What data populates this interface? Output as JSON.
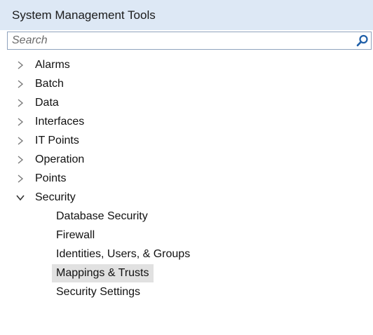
{
  "panel": {
    "title": "System Management Tools"
  },
  "search": {
    "placeholder": "Search",
    "value": ""
  },
  "tree": {
    "items": [
      {
        "label": "Alarms",
        "expanded": false
      },
      {
        "label": "Batch",
        "expanded": false
      },
      {
        "label": "Data",
        "expanded": false
      },
      {
        "label": "Interfaces",
        "expanded": false
      },
      {
        "label": "IT Points",
        "expanded": false
      },
      {
        "label": "Operation",
        "expanded": false
      },
      {
        "label": "Points",
        "expanded": false
      },
      {
        "label": "Security",
        "expanded": true
      }
    ],
    "security_children": [
      {
        "label": "Database Security",
        "selected": false
      },
      {
        "label": "Firewall",
        "selected": false
      },
      {
        "label": "Identities, Users, & Groups",
        "selected": false
      },
      {
        "label": "Mappings & Trusts",
        "selected": true
      },
      {
        "label": "Security Settings",
        "selected": false
      }
    ]
  },
  "icons": {
    "search": "search-icon",
    "collapsed": "chevron-right-icon",
    "expanded": "chevron-down-icon"
  },
  "colors": {
    "title_bar_bg": "#dde8f5",
    "search_border": "#8fa3bd",
    "selected_bg": "#e1e1e1",
    "search_icon": "#1f5fa8"
  }
}
